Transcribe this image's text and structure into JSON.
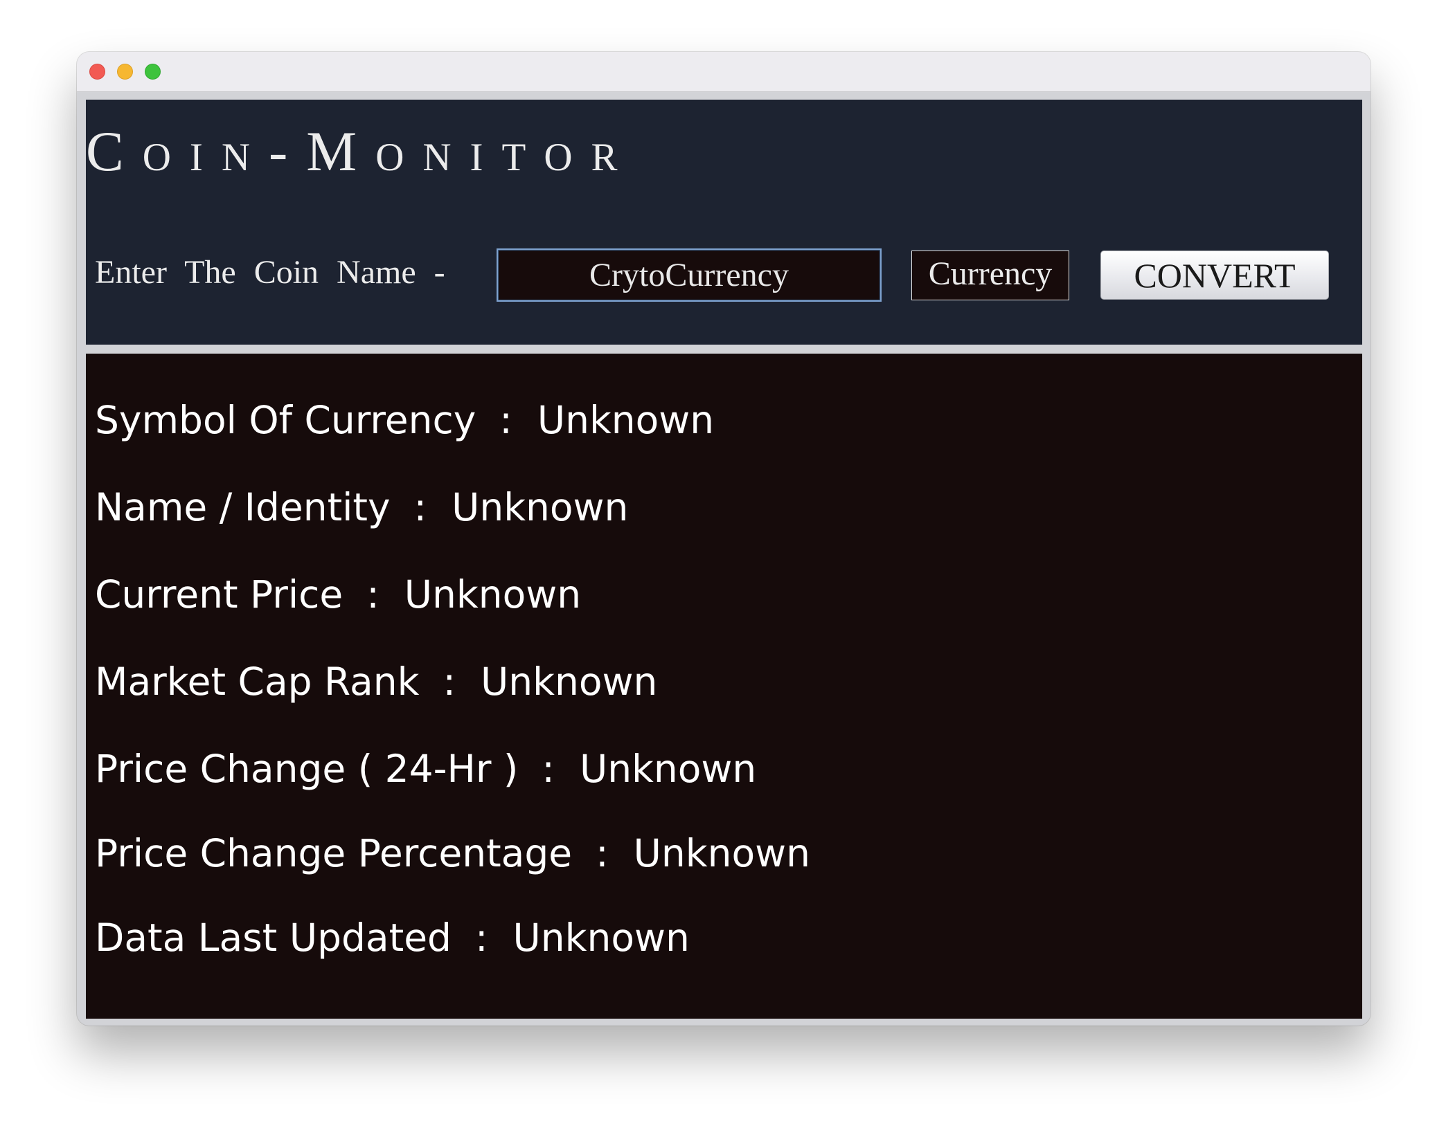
{
  "window": {
    "title_heading": "Coin-Monitor"
  },
  "search": {
    "label": "Enter The Coin Name -",
    "value": "CrytoCurrency",
    "currency_label": "Currency",
    "convert_label": "CONVERT"
  },
  "info": {
    "separator": ":",
    "rows": [
      {
        "label": "Symbol Of Currency",
        "value": "Unknown"
      },
      {
        "label": "Name / Identity",
        "value": "Unknown"
      },
      {
        "label": "Current Price",
        "value": "Unknown"
      },
      {
        "label": "Market Cap Rank",
        "value": "Unknown"
      },
      {
        "label": "Price Change ( 24-Hr )",
        "value": "Unknown"
      },
      {
        "label": "Price Change Percentage",
        "value": "Unknown"
      },
      {
        "label": "Data Last Updated",
        "value": "Unknown"
      }
    ]
  },
  "colors": {
    "header_bg": "#1d2331",
    "info_bg": "#160b0b",
    "input_border": "#7ea2cf"
  }
}
